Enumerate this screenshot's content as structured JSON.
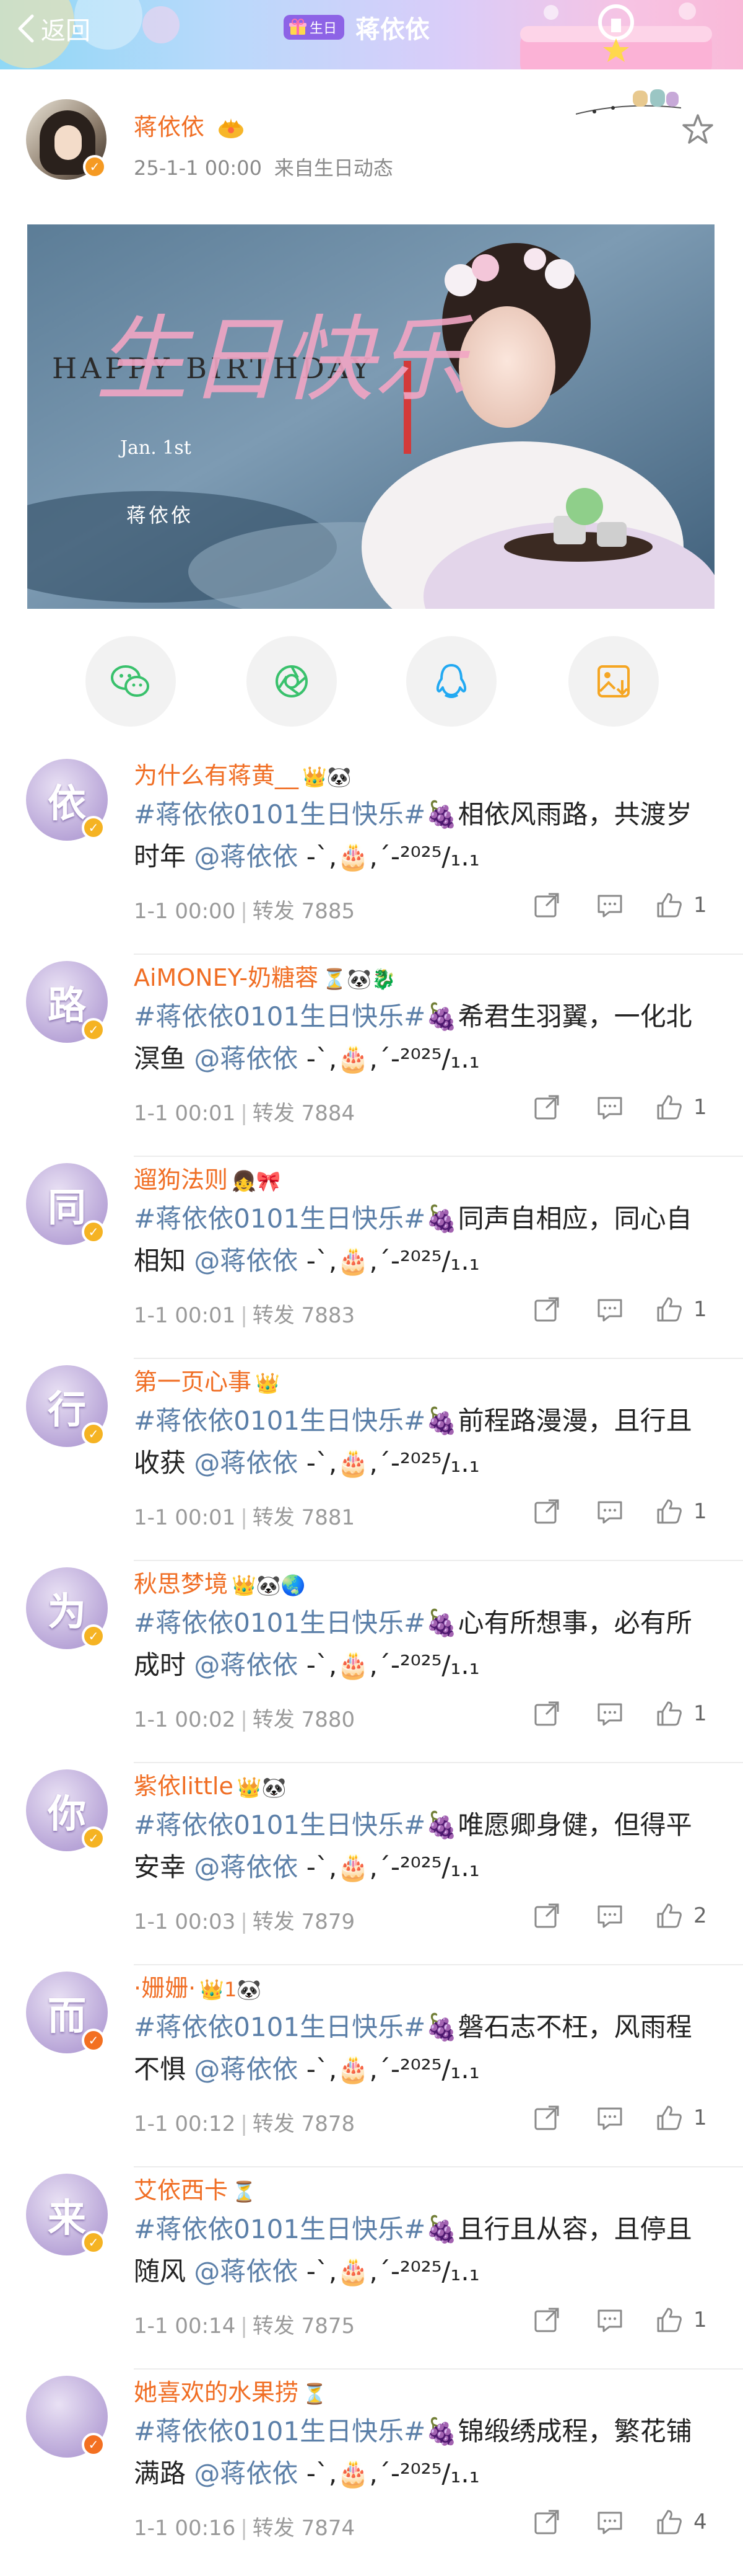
{
  "header": {
    "back_label": "返回",
    "badge_label": "生日",
    "title": "蒋依依"
  },
  "post": {
    "author": "蒋依依",
    "time": "25-1-1 00:00",
    "source": "来自生日动态",
    "banner": {
      "heading": "HAPPY BIRTHDAY",
      "script_text": "生日快乐",
      "date": "Jan. 1st",
      "name": "蒋依依"
    }
  },
  "share_buttons": [
    {
      "icon": "wechat-icon",
      "color": "#39c16c"
    },
    {
      "icon": "moments-icon",
      "color": "#39c16c"
    },
    {
      "icon": "qq-icon",
      "color": "#22a9f2"
    },
    {
      "icon": "save-image-icon",
      "color": "#f5a623"
    }
  ],
  "comments": [
    {
      "avatar_char": "依",
      "badge": "yellow",
      "name": "为什么有蒋黄__",
      "emojis": "👑🐼",
      "hashtag": "#蒋依依0101生日快乐#",
      "text": "🍇相依风雨路，共渡岁时年",
      "mention": "@蒋依依",
      "suffix": "-ˋ,🎂,ˊ-²⁰²⁵/₁.₁",
      "time": "1-1 00:00",
      "repost": "转发 7885",
      "likes": "1"
    },
    {
      "avatar_char": "路",
      "badge": "yellow",
      "name": "AiMONEY-奶糖蓉",
      "emojis": "⏳🐼🐉",
      "hashtag": "#蒋依依0101生日快乐#",
      "text": "🍇希君生羽翼，一化北溟鱼",
      "mention": "@蒋依依",
      "suffix": "-ˋ,🎂,ˊ-²⁰²⁵/₁.₁",
      "time": "1-1 00:01",
      "repost": "转发 7884",
      "likes": "1"
    },
    {
      "avatar_char": "同",
      "badge": "yellow",
      "name": "遛狗法则",
      "emojis": "👧🎀",
      "hashtag": "#蒋依依0101生日快乐#",
      "text": "🍇同声自相应，同心自相知",
      "mention": "@蒋依依",
      "suffix": "-ˋ,🎂,ˊ-²⁰²⁵/₁.₁",
      "time": "1-1 00:01",
      "repost": "转发 7883",
      "likes": "1"
    },
    {
      "avatar_char": "行",
      "badge": "yellow",
      "name": "第一页心事",
      "emojis": "👑",
      "hashtag": "#蒋依依0101生日快乐#",
      "text": "🍇前程路漫漫，且行且收获",
      "mention": "@蒋依依",
      "suffix": "-ˋ,🎂,ˊ-²⁰²⁵/₁.₁",
      "time": "1-1 00:01",
      "repost": "转发 7881",
      "likes": "1"
    },
    {
      "avatar_char": "为",
      "badge": "yellow",
      "name": "秋思梦境",
      "emojis": "👑🐼🌏",
      "hashtag": "#蒋依依0101生日快乐#",
      "text": "🍇心有所想事，必有所成时",
      "mention": "@蒋依依",
      "suffix": "-ˋ,🎂,ˊ-²⁰²⁵/₁.₁",
      "time": "1-1 00:02",
      "repost": "转发 7880",
      "likes": "1"
    },
    {
      "avatar_char": "你",
      "badge": "yellow",
      "name": "紫依little",
      "emojis": "👑🐼",
      "hashtag": "#蒋依依0101生日快乐#",
      "text": "🍇唯愿卿身健，但得平安幸",
      "mention": "@蒋依依",
      "suffix": "-ˋ,🎂,ˊ-²⁰²⁵/₁.₁",
      "time": "1-1 00:03",
      "repost": "转发 7879",
      "likes": "2"
    },
    {
      "avatar_char": "而",
      "badge": "orange",
      "name": "·姗姗·",
      "emojis": "👑1🐼",
      "hashtag": "#蒋依依0101生日快乐#",
      "text": "🍇磐石志不枉，风雨程不惧",
      "mention": "@蒋依依",
      "suffix": "-ˋ,🎂,ˊ-²⁰²⁵/₁.₁",
      "time": "1-1 00:12",
      "repost": "转发 7878",
      "likes": "1"
    },
    {
      "avatar_char": "来",
      "badge": "yellow",
      "name": "艾依西卡",
      "emojis": "⏳",
      "hashtag": "#蒋依依0101生日快乐#",
      "text": "🍇且行且从容，且停且随风",
      "mention": "@蒋依依",
      "suffix": "-ˋ,🎂,ˊ-²⁰²⁵/₁.₁",
      "time": "1-1 00:14",
      "repost": "转发 7875",
      "likes": "1"
    },
    {
      "avatar_char": "",
      "badge": "orange",
      "name": "她喜欢的水果捞",
      "emojis": "⏳",
      "hashtag": "#蒋依依0101生日快乐#",
      "text": "🍇锦缎绣成程，繁花铺满路",
      "mention": "@蒋依依",
      "suffix": "-ˋ,🎂,ˊ-²⁰²⁵/₁.₁",
      "time": "1-1 00:16",
      "repost": "转发 7874",
      "likes": "4"
    }
  ]
}
